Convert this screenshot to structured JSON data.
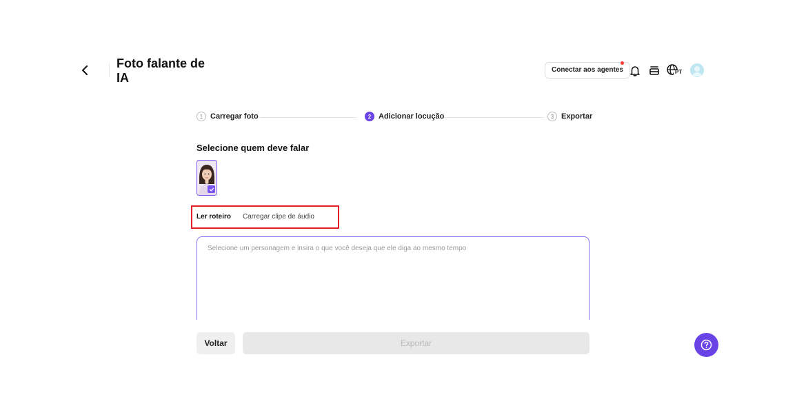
{
  "header": {
    "title": "Foto falante de IA",
    "connect_agents_label": "Conectar aos agentes",
    "language_code": "PT",
    "icons": [
      "back-arrow-icon",
      "bell-icon",
      "coins-icon",
      "globe-icon",
      "avatar"
    ]
  },
  "stepper": {
    "steps": [
      {
        "number": "1",
        "label": "Carregar foto",
        "active": false
      },
      {
        "number": "2",
        "label": "Adicionar locução",
        "active": true
      },
      {
        "number": "3",
        "label": "Exportar",
        "active": false
      }
    ]
  },
  "speaker": {
    "section_title": "Selecione quem deve falar",
    "selected_count": 1
  },
  "tabs": {
    "read_script": "Ler roteiro",
    "upload_audio": "Carregar clipe de áudio",
    "active": "read_script"
  },
  "script": {
    "value": "",
    "placeholder": "Selecione um personagem e insira o que você deseja que ele diga ao mesmo tempo"
  },
  "footer": {
    "back_label": "Voltar",
    "export_label": "Exportar",
    "export_enabled": false
  },
  "colors": {
    "accent": "#6a43e6",
    "highlight": "#e0202a",
    "notification_dot": "#ff3b30"
  }
}
